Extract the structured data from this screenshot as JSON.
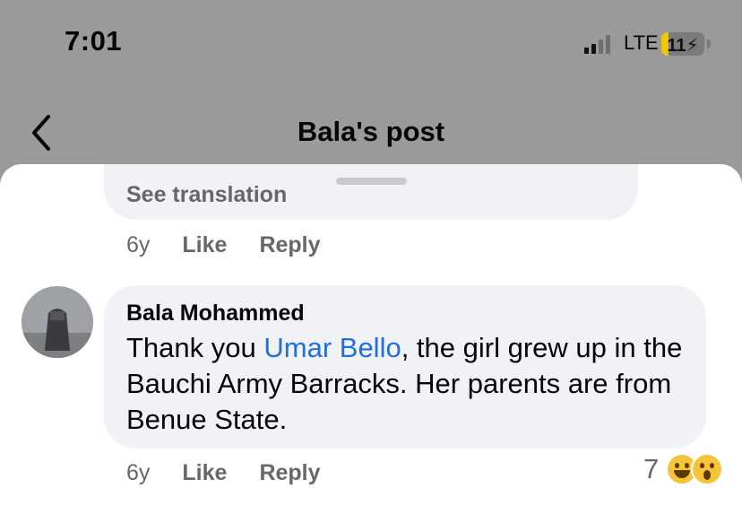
{
  "status_bar": {
    "time": "7:01",
    "network": "LTE",
    "battery": "11",
    "battery_charging_icon": "bolt-icon"
  },
  "nav": {
    "back_icon": "chevron-left-icon",
    "title": "Bala's post"
  },
  "previous_comment": {
    "see_translation": "See translation",
    "age": "6y",
    "like": "Like",
    "reply": "Reply"
  },
  "comment": {
    "author": "Bala Mohammed",
    "text_before": "Thank you ",
    "mention": "Umar Bello",
    "text_after": ", the girl grew up in the Bauchi Army Barracks.  Her parents are from Benue State.",
    "age": "6y",
    "like": "Like",
    "reply": "Reply",
    "reaction_count": "7",
    "reaction_icons": [
      "laughing-emoji-icon",
      "wow-emoji-icon"
    ]
  },
  "colors": {
    "overlay": "#9a9a9a",
    "bubble": "#f0f2f5",
    "secondary_text": "#65676b",
    "mention": "#216fdb",
    "battery_fill": "#f0c800"
  }
}
